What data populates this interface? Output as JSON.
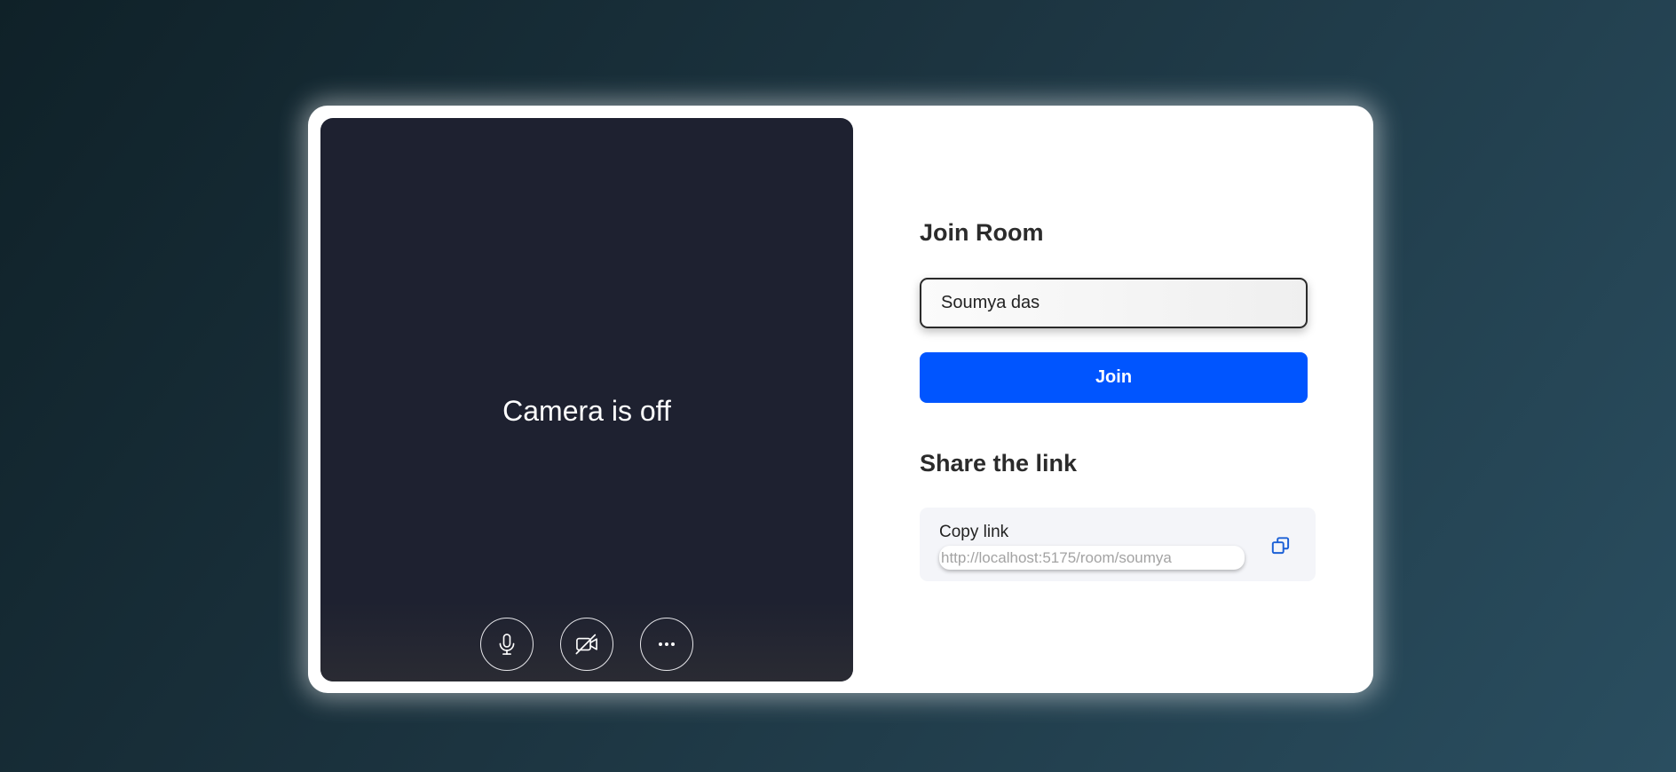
{
  "preview": {
    "camera_message": "Camera is off",
    "controls": [
      {
        "name": "microphone",
        "icon": "microphone-icon"
      },
      {
        "name": "camera",
        "icon": "camera-off-icon"
      },
      {
        "name": "more",
        "icon": "more-horizontal-icon"
      }
    ]
  },
  "join": {
    "title": "Join Room",
    "name_value": "Soumya das",
    "button_label": "Join"
  },
  "share": {
    "title": "Share the link",
    "copy_label": "Copy link",
    "link_url": "http://localhost:5175/room/soumya",
    "copy_icon": "copy-icon"
  },
  "colors": {
    "accent": "#0055ff",
    "preview_bg": "#1e2130",
    "card_bg": "#ffffff"
  }
}
